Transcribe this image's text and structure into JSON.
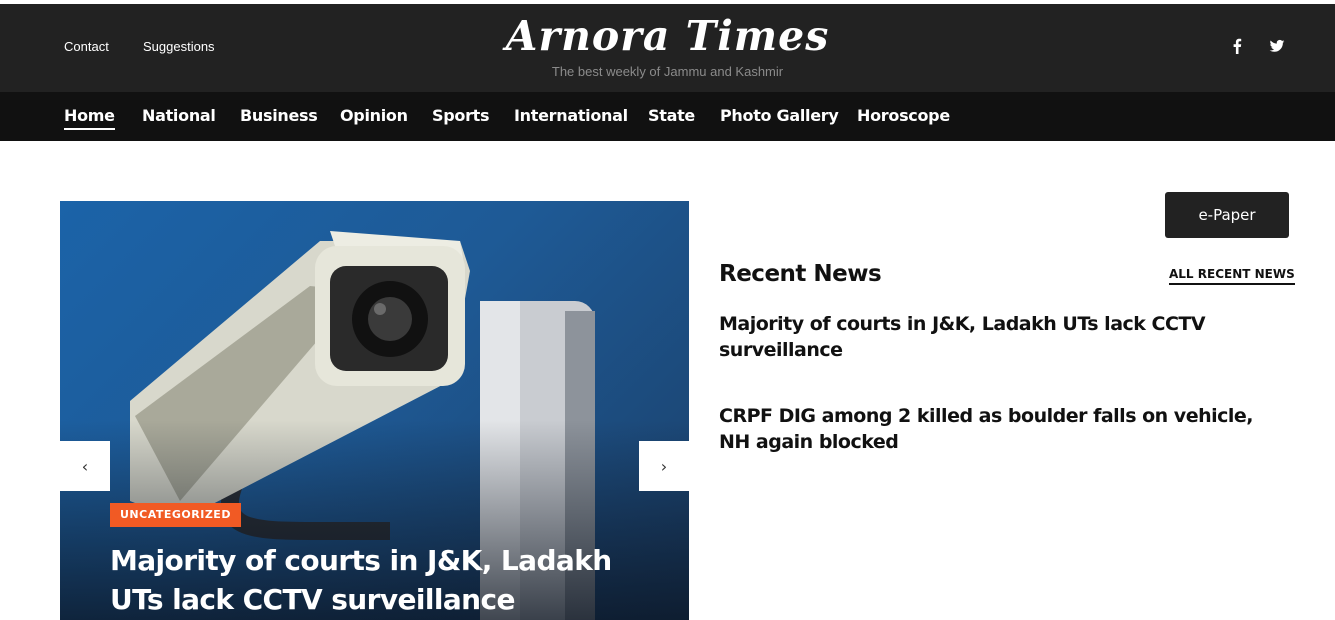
{
  "header": {
    "links": [
      "Contact",
      "Suggestions"
    ],
    "title": "Arnora Times",
    "tagline": "The best weekly of Jammu and Kashmir",
    "social_icons": [
      "facebook-icon",
      "twitter-icon"
    ]
  },
  "nav": {
    "items": [
      "Home",
      "National",
      "Business",
      "Opinion",
      "Sports",
      "International",
      "State",
      "Photo Gallery",
      "Horoscope"
    ],
    "active": "Home"
  },
  "hero": {
    "category": "UNCATEGORIZED",
    "title": "Majority of courts in J&K, Ladakh UTs lack CCTV surveillance",
    "prev_icon": "chevron-left-icon",
    "next_icon": "chevron-right-icon"
  },
  "sidebar": {
    "epaper_label": "e-Paper",
    "heading": "Recent News",
    "all_link": "ALL RECENT NEWS",
    "items": [
      "Majority of courts in J&K, Ladakh UTs lack CCTV surveillance",
      "CRPF DIG among 2 killed as boulder falls on vehicle, NH again blocked"
    ]
  },
  "colors": {
    "topbar": "#222222",
    "navbar": "#111111",
    "badge": "#f15a24",
    "hero_blue": "#1e5a96"
  }
}
